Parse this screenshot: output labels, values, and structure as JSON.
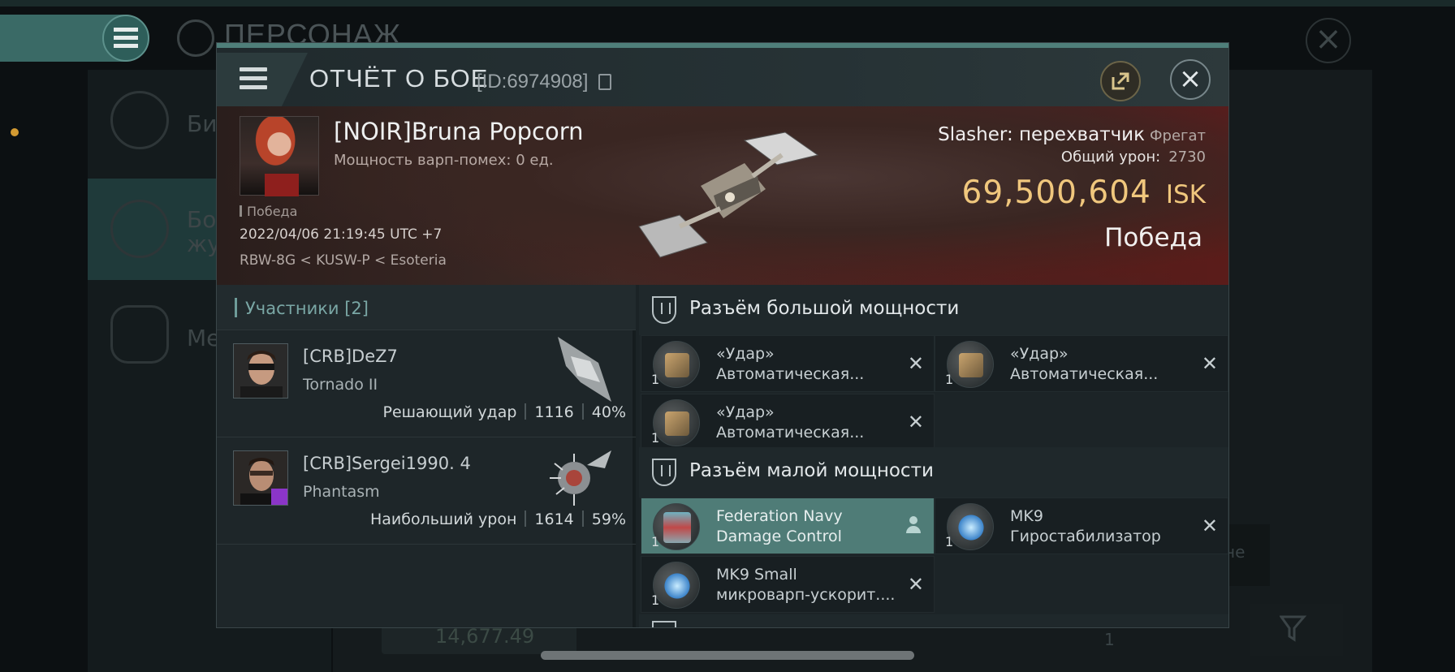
{
  "background": {
    "title": "ПЕРСОНАЖ",
    "left_items": [
      {
        "label": "Би"
      },
      {
        "label": "Бо\nжу"
      },
      {
        "label": "Ме"
      }
    ],
    "bottom_value": "14,677.49",
    "right_value": "1",
    "right_hint": "не"
  },
  "header": {
    "title": "ОТЧЁТ О БОЕ",
    "id_label": "[ID:6974908]"
  },
  "victim": {
    "name": "[NOIR]Bruna Popcorn",
    "warp_disrupt": "Мощность варп-помех: 0 ед.",
    "result_tag": "Победа",
    "datetime": "2022/04/06 21:19:45 UTC +7",
    "location": "RBW-8G < KUSW-P < Esoteria",
    "ship_name": "Slasher: перехватчик",
    "ship_class": "Фрегат",
    "damage_label": "Общий урон:",
    "damage_value": "2730",
    "isk_value": "69,500,604",
    "isk_unit": "ISK",
    "outcome": "Победа"
  },
  "participants": {
    "title": "Участники [2]",
    "rows": [
      {
        "name": "[CRB]DeZ7",
        "ship": "Tornado II",
        "role": "Решающий удар",
        "damage": "1116",
        "percent": "40%"
      },
      {
        "name": "[CRB]Sergei1990. 4",
        "ship": "Phantasm",
        "role": "Наибольший урон",
        "damage": "1614",
        "percent": "59%"
      }
    ]
  },
  "fittings": {
    "high_slot_title": "Разъём большой мощности",
    "high_modules": [
      {
        "line1": "«Удар»",
        "line2": "Автоматическая...",
        "qty": "1"
      },
      {
        "line1": "«Удар»",
        "line2": "Автоматическая...",
        "qty": "1"
      },
      {
        "line1": "«Удар»",
        "line2": "Автоматическая...",
        "qty": "1"
      }
    ],
    "low_slot_title": "Разъём малой мощности",
    "low_modules": [
      {
        "line1": "Federation Navy",
        "line2": "Damage Control",
        "qty": "1"
      },
      {
        "line1": "MK9",
        "line2": "Гиростабилизатор",
        "qty": "1"
      },
      {
        "line1": "MK9 Small",
        "line2": "микроварп-ускорит....",
        "qty": "1"
      }
    ]
  },
  "colors": {
    "accent": "#4f7f7a",
    "isk": "#f0c77d",
    "highlight_module": "#4f7c77",
    "corp_badge": "#8b35c8"
  }
}
